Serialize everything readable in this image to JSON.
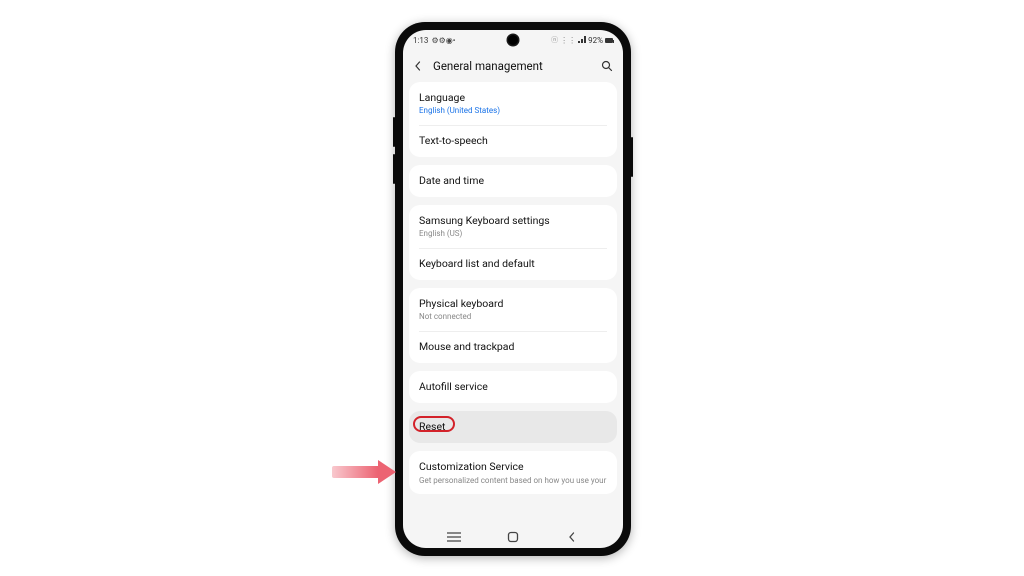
{
  "statusbar": {
    "time": "1:13",
    "left_icons": "⚙ ⚙ ◉ •",
    "battery_text": "92%"
  },
  "header": {
    "title": "General management"
  },
  "groups": [
    {
      "rows": [
        {
          "title": "Language",
          "sub": "English (United States)",
          "sub_link": true
        },
        {
          "title": "Text-to-speech"
        }
      ]
    },
    {
      "rows": [
        {
          "title": "Date and time"
        }
      ]
    },
    {
      "rows": [
        {
          "title": "Samsung Keyboard settings",
          "sub": "English (US)"
        },
        {
          "title": "Keyboard list and default"
        }
      ]
    },
    {
      "rows": [
        {
          "title": "Physical keyboard",
          "sub": "Not connected"
        },
        {
          "title": "Mouse and trackpad"
        }
      ]
    },
    {
      "rows": [
        {
          "title": "Autofill service"
        }
      ]
    },
    {
      "highlight": true,
      "rows": [
        {
          "title": "Reset"
        }
      ]
    },
    {
      "rows": [
        {
          "title": "Customization Service",
          "sub": "Get personalized content based on how you use your"
        }
      ]
    }
  ]
}
